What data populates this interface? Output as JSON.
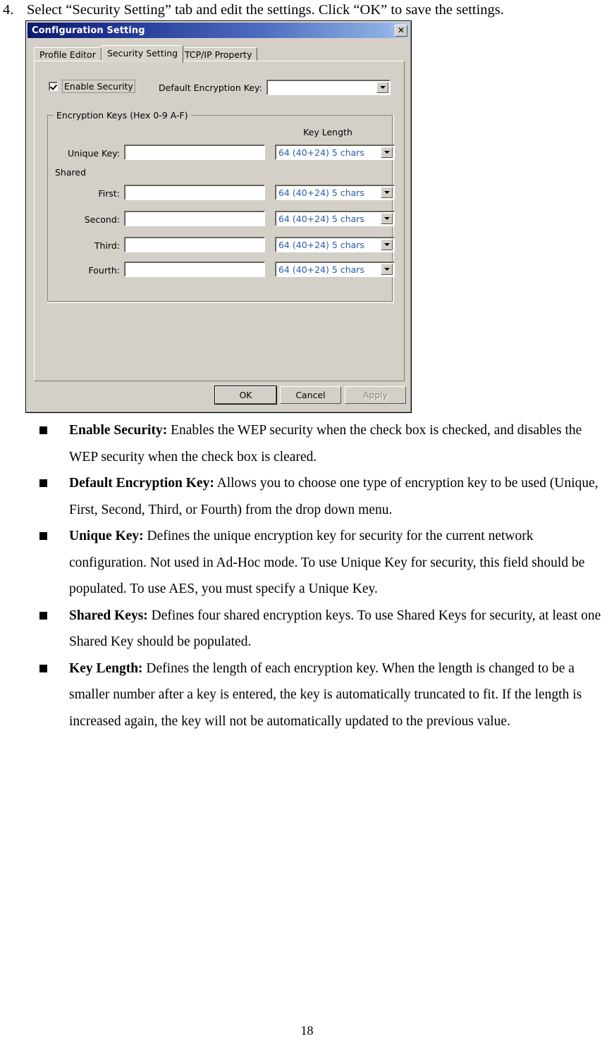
{
  "document": {
    "step": {
      "number": "4.",
      "text": "Select “Security Setting” tab and edit the settings. Click “OK” to save the settings."
    },
    "bullets": [
      {
        "term": "Enable Security:",
        "body": " Enables the WEP security when the check box is checked, and disables the WEP security when the check box is cleared."
      },
      {
        "term": "Default Encryption Key:",
        "body": " Allows you to choose one type of encryption key to be used (Unique, First, Second, Third, or Fourth) from the drop down menu."
      },
      {
        "term": "Unique Key:",
        "body": " Defines the unique encryption key for security for the current network configuration. Not used in Ad-Hoc mode. To use Unique Key for security, this field should be populated. To use AES, you must specify a Unique Key."
      },
      {
        "term": "Shared Keys:",
        "body": " Defines four shared encryption keys. To use Shared Keys for security, at least one Shared Key should be populated."
      },
      {
        "term": "Key Length:",
        "body": " Defines the length of each encryption key. When the length is changed to be a smaller number after a key is entered, the key is automatically truncated to fit.  If the length is increased again, the key will not be automatically updated to the previous value."
      }
    ],
    "page_number": "18"
  },
  "dialog": {
    "title": "Configuration Setting",
    "close_icon": "close-icon",
    "tabs": [
      {
        "label": "Profile Editor",
        "selected": false
      },
      {
        "label": "Security Setting",
        "selected": true
      },
      {
        "label": "TCP/IP Property",
        "selected": false
      }
    ],
    "enable_security": {
      "label": "Enable Security",
      "checked": true
    },
    "default_encryption_key": {
      "label": "Default Encryption Key:",
      "value": "",
      "dropdown_icon": "chevron-down-icon"
    },
    "encryption_keys_group": {
      "title": "Encryption Keys (Hex 0-9 A-F)",
      "key_length_header": "Key Length",
      "shared_label": "Shared",
      "rows": [
        {
          "label": "Unique Key:",
          "value": "",
          "key_length": "64  (40+24)  5 chars"
        },
        {
          "label": "First:",
          "value": "",
          "key_length": "64  (40+24)  5 chars"
        },
        {
          "label": "Second:",
          "value": "",
          "key_length": "64  (40+24)  5 chars"
        },
        {
          "label": "Third:",
          "value": "",
          "key_length": "64  (40+24)  5 chars"
        },
        {
          "label": "Fourth:",
          "value": "",
          "key_length": "64  (40+24)  5 chars"
        }
      ]
    },
    "buttons": {
      "ok": "OK",
      "cancel": "Cancel",
      "apply": "Apply",
      "apply_disabled": true
    },
    "colors": {
      "titlebar_start": "#0b1a6e",
      "titlebar_end": "#b9d0f0",
      "dialog_face": "#d4d0c8",
      "combo_text": "#2a5caa",
      "disabled_text": "#8a867e"
    }
  }
}
